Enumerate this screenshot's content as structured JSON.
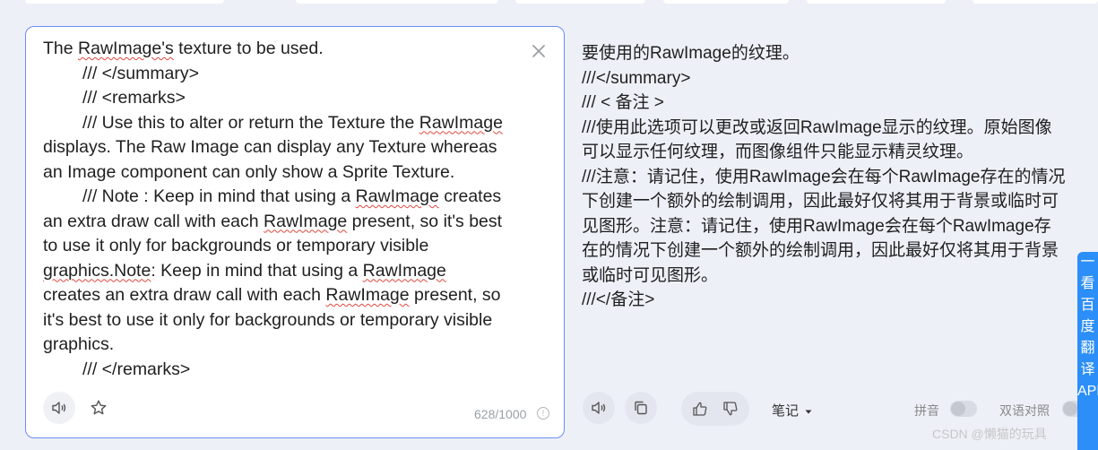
{
  "source": {
    "lines": [
      {
        "indent": false,
        "segments": [
          {
            "t": "The "
          },
          {
            "t": "RawImage's",
            "u": true
          },
          {
            "t": " texture to be used."
          }
        ]
      },
      {
        "indent": true,
        "segments": [
          {
            "t": "/// </summary>"
          }
        ]
      },
      {
        "indent": true,
        "segments": [
          {
            "t": "/// <remarks>"
          }
        ]
      },
      {
        "indent": true,
        "segments": [
          {
            "t": "/// Use this to alter or return the Texture the "
          },
          {
            "t": "RawImage",
            "u": true
          }
        ]
      },
      {
        "indent": false,
        "segments": [
          {
            "t": "displays. The Raw Image can display any Texture whereas"
          }
        ]
      },
      {
        "indent": false,
        "segments": [
          {
            "t": "an Image component can only show a Sprite Texture."
          }
        ]
      },
      {
        "indent": true,
        "segments": [
          {
            "t": "/// Note : Keep in mind that using a "
          },
          {
            "t": "RawImage",
            "u": true
          },
          {
            "t": " creates"
          }
        ]
      },
      {
        "indent": false,
        "segments": [
          {
            "t": "an extra draw call with each "
          },
          {
            "t": "RawImage",
            "u": true
          },
          {
            "t": " present, so it's best"
          }
        ]
      },
      {
        "indent": false,
        "segments": [
          {
            "t": "to use it only for backgrounds or temporary visible"
          }
        ]
      },
      {
        "indent": false,
        "segments": [
          {
            "t": "graphics.Note",
            "u": true
          },
          {
            "t": ": Keep in mind that using a "
          },
          {
            "t": "RawImage",
            "u": true
          }
        ]
      },
      {
        "indent": false,
        "segments": [
          {
            "t": "creates an extra draw call with each "
          },
          {
            "t": "RawImage",
            "u": true
          },
          {
            "t": " present, so"
          }
        ]
      },
      {
        "indent": false,
        "segments": [
          {
            "t": "it's best to use it only for backgrounds or temporary visible"
          }
        ]
      },
      {
        "indent": false,
        "segments": [
          {
            "t": "graphics."
          }
        ]
      },
      {
        "indent": true,
        "segments": [
          {
            "t": "/// </remarks>"
          }
        ]
      }
    ],
    "char_count": "628/1000",
    "clear_icon": "close-icon",
    "speaker_icon": "speaker-icon",
    "star_icon": "star-icon",
    "info_icon": "info-icon",
    "info_glyph": "!"
  },
  "target": {
    "lines": [
      "要使用的RawImage的纹理。",
      "///</summary>",
      "/// < 备注 >",
      "///使用此选项可以更改或返回RawImage显示的纹理。原始图像",
      "可以显示任何纹理，而图像组件只能显示精灵纹理。",
      "///注意：请记住，使用RawImage会在每个RawImage存在的情况",
      "下创建一个额外的绘制调用，因此最好仅将其用于背景或临时可",
      "见图形。注意：请记住，使用RawImage会在每个RawImage存",
      "在的情况下创建一个额外的绘制调用，因此最好仅将其用于背景",
      "或临时可见图形。",
      "///</备注>"
    ],
    "notes_label": "笔记",
    "pinyin_label": "拼音",
    "bilingual_label": "双语对照"
  },
  "side_float_text": "一 看 百 度 翻 译 APP",
  "watermark": "CSDN @懒猫的玩具",
  "colors": {
    "accent": "#2c8ef8",
    "panel_border": "#6c8ef5",
    "spell_underline": "#e0483e",
    "background": "#eef0f8"
  }
}
